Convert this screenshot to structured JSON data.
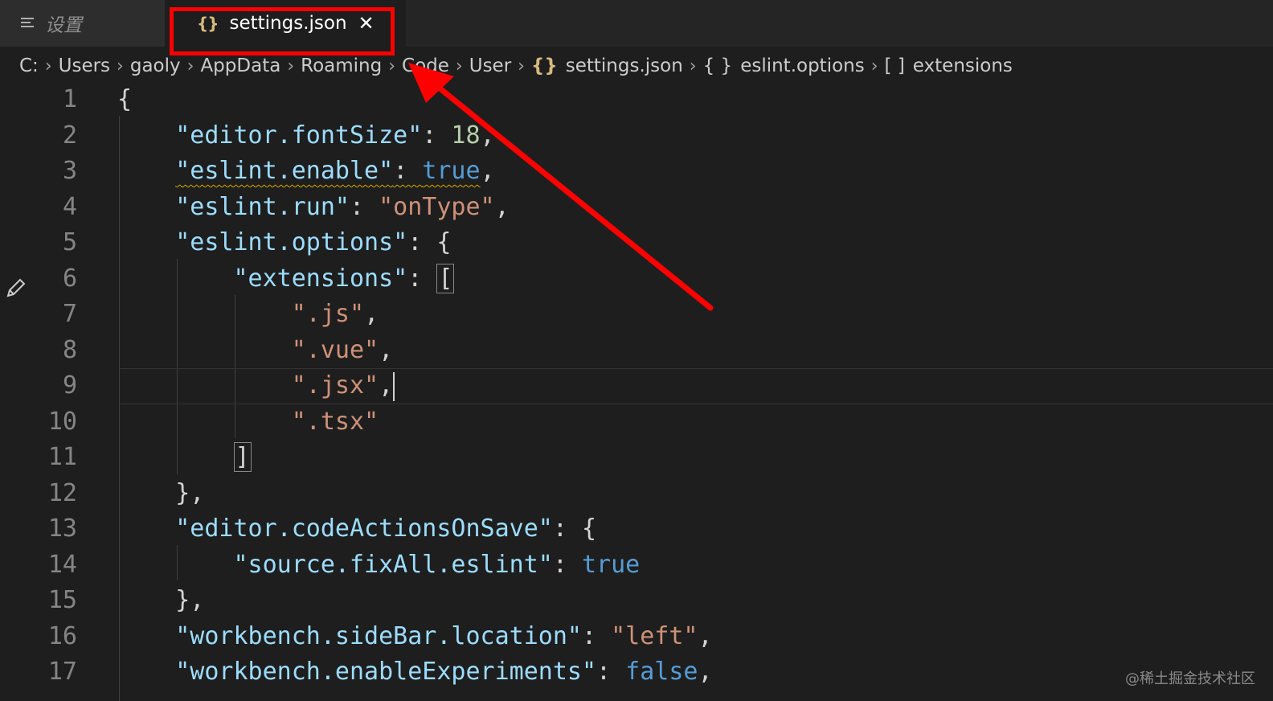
{
  "tabs": {
    "settings_ui_label": "设置",
    "json_label": "settings.json",
    "json_icon": "{}",
    "close_glyph": "✕"
  },
  "breadcrumbs": [
    "C:",
    "Users",
    "gaoly",
    "AppData",
    "Roaming",
    "Code",
    "User",
    "settings.json",
    "eslint.options",
    "extensions"
  ],
  "breadcrumb_icons": {
    "file": "{}",
    "object": "{ }",
    "array": "[ ]"
  },
  "line_numbers": [
    "1",
    "2",
    "3",
    "4",
    "5",
    "6",
    "7",
    "8",
    "9",
    "10",
    "11",
    "12",
    "13",
    "14",
    "15",
    "16",
    "17"
  ],
  "code": {
    "l1": "{",
    "l2_key": "\"editor.fontSize\"",
    "l2_val": "18",
    "l3_key": "\"eslint.enable\"",
    "l3_val": "true",
    "l4_key": "\"eslint.run\"",
    "l4_val": "\"onType\"",
    "l5_key": "\"eslint.options\"",
    "l5_open": "{",
    "l6_key": "\"extensions\"",
    "l6_open": "[",
    "l7": "\".js\"",
    "l8": "\".vue\"",
    "l9": "\".jsx\"",
    "l10": "\".tsx\"",
    "l11": "]",
    "l12": "},",
    "l13_key": "\"editor.codeActionsOnSave\"",
    "l13_open": "{",
    "l14_key": "\"source.fixAll.eslint\"",
    "l14_val": "true",
    "l15": "},",
    "l16_key": "\"workbench.sideBar.location\"",
    "l16_val": "\"left\"",
    "l17_key": "\"workbench.enableExperiments\"",
    "l17_val": "false"
  },
  "watermark": "@稀土掘金技术社区",
  "colors": {
    "annotation": "#ff0000",
    "editor_bg": "#1e1e1e",
    "key": "#9cdcfe",
    "string": "#ce9178",
    "number": "#b5cea8",
    "boolean": "#569cd6"
  }
}
